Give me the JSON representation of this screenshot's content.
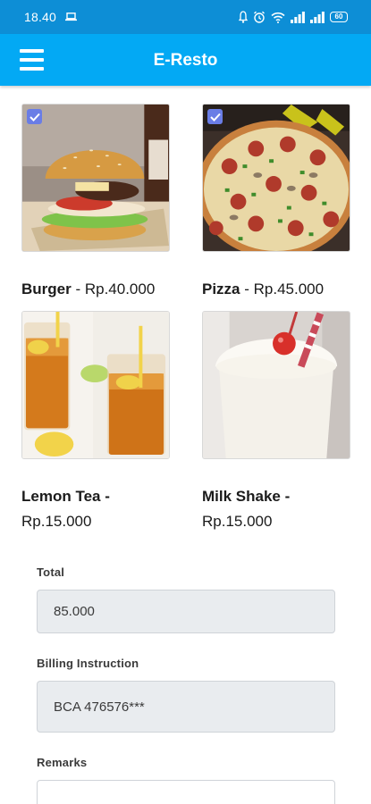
{
  "status_bar": {
    "time": "18.40",
    "battery": "60"
  },
  "app_bar": {
    "title": "E-Resto"
  },
  "menu_items": [
    {
      "name": "Burger",
      "price": " - Rp.40.000",
      "checked": true,
      "image": "burger"
    },
    {
      "name": "Pizza",
      "price": " - Rp.45.000",
      "checked": true,
      "image": "pizza"
    },
    {
      "name": "Lemon Tea",
      "price_suffix": " -",
      "price": "Rp.15.000",
      "checked": false,
      "image": "lemon-tea"
    },
    {
      "name": "Milk Shake",
      "price_suffix": " -",
      "price": "Rp.15.000",
      "checked": false,
      "image": "milk-shake"
    }
  ],
  "form": {
    "total_label": "Total",
    "total_value": "85.000",
    "billing_label": "Billing Instruction",
    "billing_value": "BCA 476576***",
    "remarks_label": "Remarks",
    "remarks_value": ""
  },
  "colors": {
    "status_bar": "#0d8ed6",
    "app_bar": "#03a9f4",
    "checkbox": "#6a7de6",
    "field_background": "#e9ecef"
  }
}
